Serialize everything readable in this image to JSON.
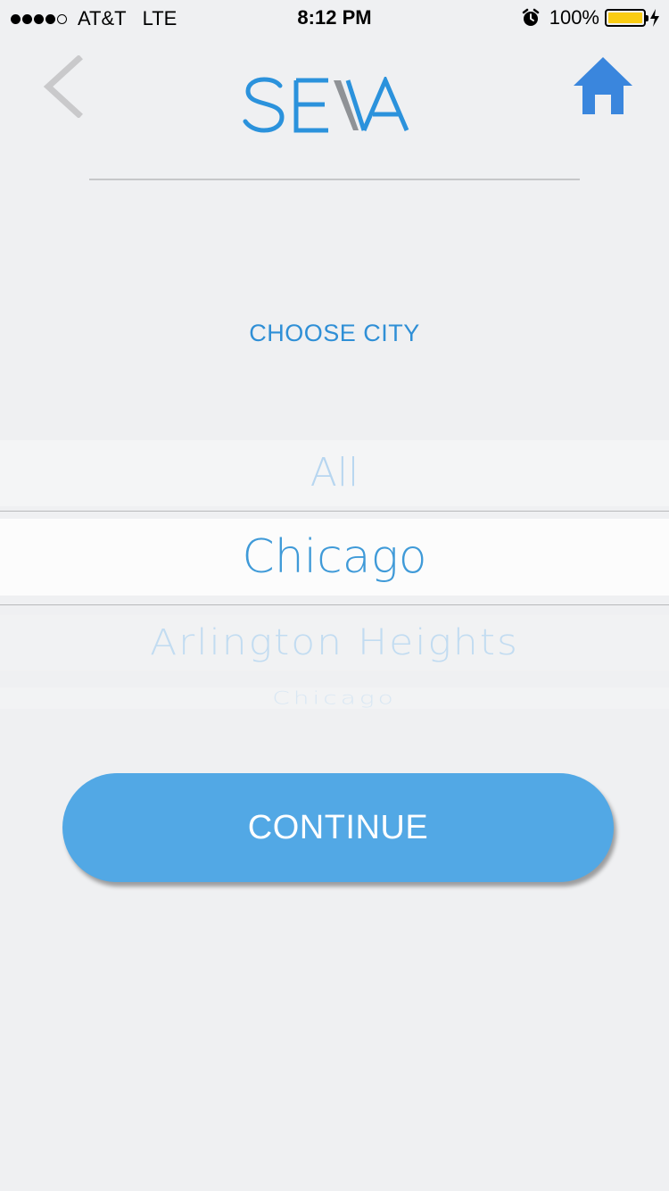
{
  "status_bar": {
    "carrier": "AT&T",
    "network": "LTE",
    "time": "8:12 PM",
    "battery_percent": "100%",
    "battery_color": "#f9cc13",
    "signal_bars": 4,
    "signal_max": 5,
    "icons": [
      "alarm-icon",
      "battery-icon",
      "charging-bolt-icon"
    ]
  },
  "nav": {
    "back_icon": "chevron-left-icon",
    "home_icon": "home-icon",
    "home_color": "#3a86dd",
    "logo_text": "SEVA"
  },
  "heading": "CHOOSE CITY",
  "picker": {
    "above": "All",
    "selected": "Chicago",
    "below": "Arlington Heights",
    "below2": "Chicago"
  },
  "continue_label": "CONTINUE",
  "colors": {
    "accent": "#2b92dc",
    "button": "#52a8e5",
    "background": "#eff0f2"
  }
}
